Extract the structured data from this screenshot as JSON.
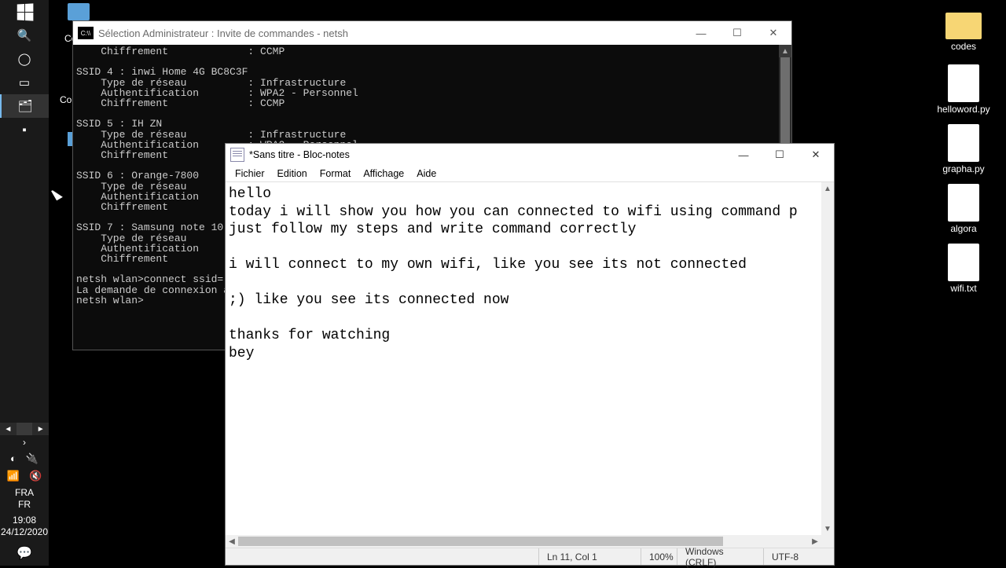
{
  "taskbar": {
    "lang1": "FRA",
    "lang2": "FR",
    "time": "19:08",
    "date": "24/12/2020"
  },
  "desktop": {
    "left": {
      "ce": "Ce",
      "cor": "Cor"
    },
    "right": [
      {
        "label": "codes",
        "kind": "folder"
      },
      {
        "label": "helloword.py",
        "kind": "white"
      },
      {
        "label": "grapha.py",
        "kind": "white"
      },
      {
        "label": "algora",
        "kind": "white"
      },
      {
        "label": "wifi.txt",
        "kind": "white"
      }
    ]
  },
  "cmd": {
    "title": "Sélection Administrateur : Invite de commandes - netsh",
    "body": "    Chiffrement             : CCMP\n\nSSID 4 : inwi Home 4G BC8C3F\n    Type de réseau          : Infrastructure\n    Authentification        : WPA2 - Personnel\n    Chiffrement             : CCMP\n\nSSID 5 : IH ZN\n    Type de réseau          : Infrastructure\n    Authentification        : WPA2 - Personnel\n    Chiffrement\n\nSSID 6 : Orange-7800\n    Type de réseau\n    Authentification\n    Chiffrement\n\nSSID 7 : Samsung note 10 p\n    Type de réseau\n    Authentification\n    Chiffrement\n\nnetsh wlan>connect ssid=\"A\nLa demande de connexion a\nnetsh wlan>"
  },
  "notepad": {
    "title": "*Sans titre - Bloc-notes",
    "menu": {
      "fichier": "Fichier",
      "edition": "Edition",
      "format": "Format",
      "affichage": "Affichage",
      "aide": "Aide"
    },
    "content": "hello\ntoday i will show you how you can connected to wifi using command p\njust follow my steps and write command correctly\n\ni will connect to my own wifi, like you see its not connected\n\n;) like you see its connected now\n\nthanks for watching\nbey",
    "status": {
      "pos": "Ln 11, Col 1",
      "zoom": "100%",
      "eol": "Windows (CRLF)",
      "enc": "UTF-8"
    }
  }
}
